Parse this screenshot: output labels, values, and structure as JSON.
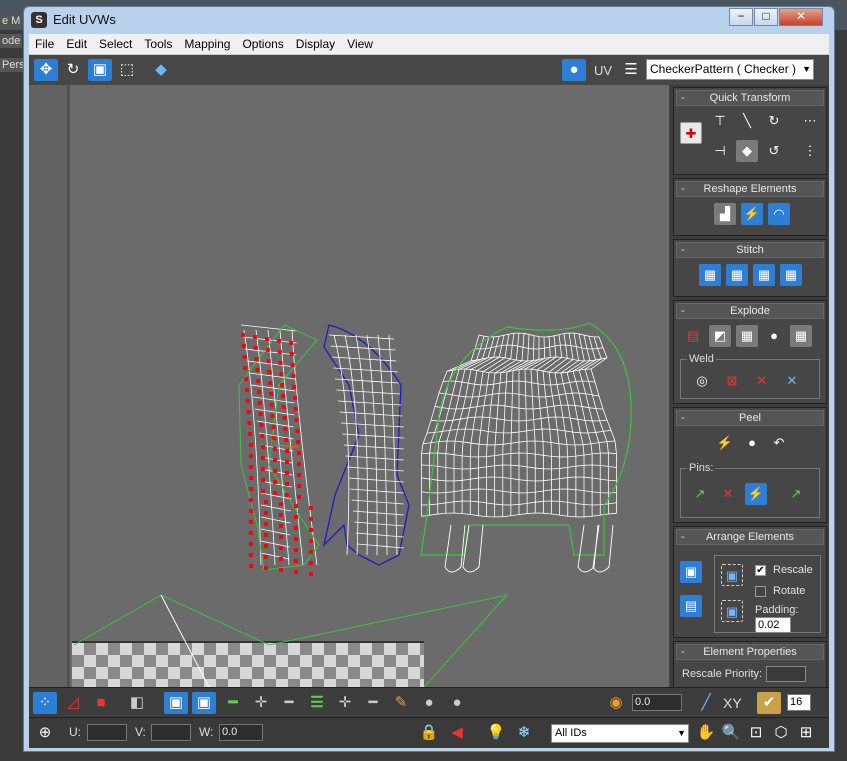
{
  "window": {
    "title": "Edit UVWs",
    "app_icon": "S"
  },
  "backdrop": {
    "labels": [
      "e M",
      "ode",
      "Pers"
    ]
  },
  "title_buttons": {
    "minimize": "−",
    "maximize": "□",
    "close": "✕"
  },
  "menu": [
    "File",
    "Edit",
    "Select",
    "Tools",
    "Mapping",
    "Options",
    "Display",
    "View"
  ],
  "toolbar": {
    "move": "✥",
    "rotate": "↻",
    "scale": "▣",
    "freeform": "⬚",
    "mirror": "◆",
    "uv_label": "UV",
    "texture": "CheckerPattern  ( Checker )"
  },
  "panel": {
    "quick_transform": "Quick Transform",
    "reshape_elements": "Reshape Elements",
    "stitch": "Stitch",
    "explode": "Explode",
    "weld": "Weld",
    "peel": "Peel",
    "pins": "Pins:",
    "arrange_elements": "Arrange Elements",
    "rescale": "Rescale",
    "rescale_checked": "✔",
    "rotate": "Rotate",
    "padding": "Padding:",
    "padding_value": "0.02",
    "element_properties": "Element Properties",
    "rescale_priority": "Rescale Priority:"
  },
  "bottom": {
    "soft_value": "0.0",
    "xy_label": "XY",
    "grid_value": "16",
    "u_label": "U:",
    "v_label": "V:",
    "w_label": "W:",
    "w_value": "0.0",
    "ids": "All IDs"
  },
  "colors": {
    "selected_verts": "#ff0000",
    "open_edge": "#3cc43c",
    "border_blue": "#1e1ebe",
    "mesh": "#ffffff",
    "accent": "#2d7fd6"
  }
}
